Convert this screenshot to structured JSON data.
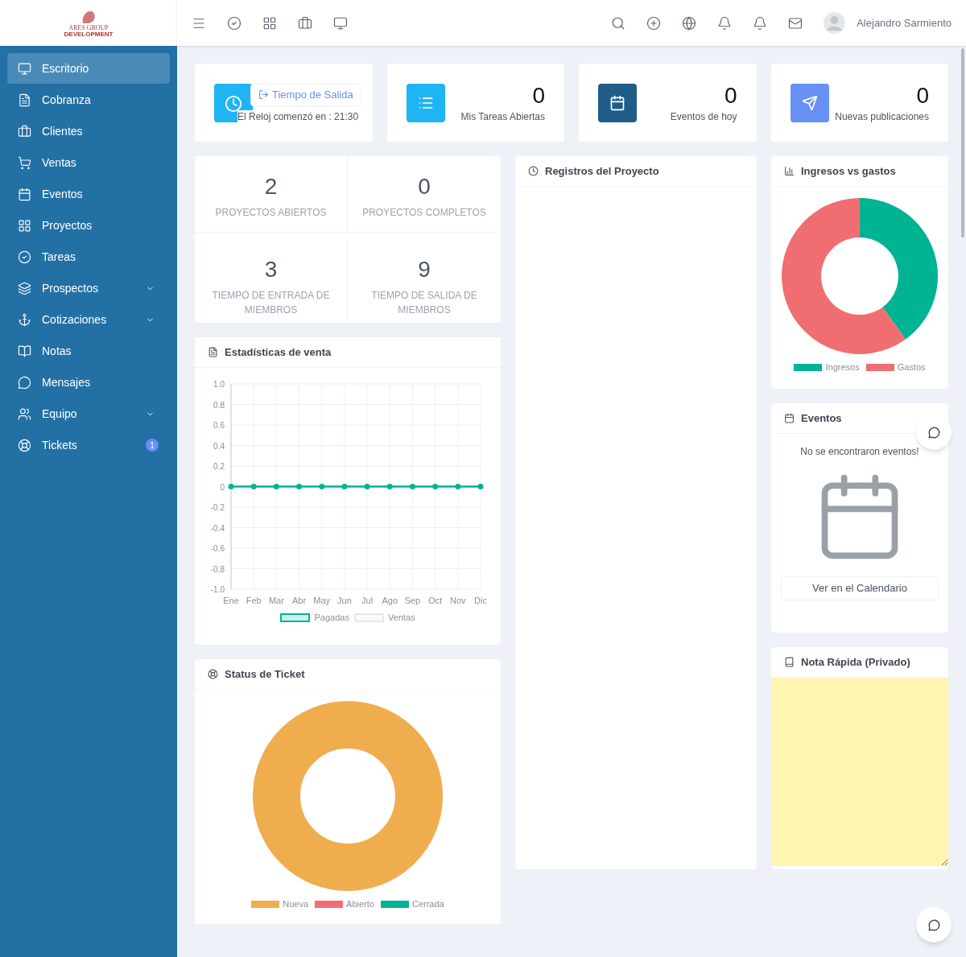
{
  "header": {
    "user_name": "Alejandro Sarmiento"
  },
  "logo": {
    "name": "ARES GROUP",
    "tagline": "DEVELOPMENT"
  },
  "sidebar": {
    "items": [
      {
        "label": "Escritorio",
        "selected": true,
        "has_submenu": false
      },
      {
        "label": "Cobranza",
        "selected": false,
        "has_submenu": false
      },
      {
        "label": "Clientes",
        "selected": false,
        "has_submenu": false
      },
      {
        "label": "Ventas",
        "selected": false,
        "has_submenu": false
      },
      {
        "label": "Eventos",
        "selected": false,
        "has_submenu": false
      },
      {
        "label": "Proyectos",
        "selected": false,
        "has_submenu": false
      },
      {
        "label": "Tareas",
        "selected": false,
        "has_submenu": false
      },
      {
        "label": "Prospectos",
        "selected": false,
        "has_submenu": true
      },
      {
        "label": "Cotizaciones",
        "selected": false,
        "has_submenu": true
      },
      {
        "label": "Notas",
        "selected": false,
        "has_submenu": false
      },
      {
        "label": "Mensajes",
        "selected": false,
        "has_submenu": false
      },
      {
        "label": "Equipo",
        "selected": false,
        "has_submenu": true
      },
      {
        "label": "Tickets",
        "selected": false,
        "has_submenu": false,
        "badge": "1"
      }
    ]
  },
  "clock_card": {
    "button": "Tiempo de Salida",
    "text": "El Reloj comenzó en : 21:30"
  },
  "stat_cards": [
    {
      "value": "0",
      "label": "Mis Tareas Abiertas",
      "color": "#1fb5f5"
    },
    {
      "value": "0",
      "label": "Eventos de hoy",
      "color": "#1f5c8a"
    },
    {
      "value": "0",
      "label": "Nuevas publicaciones",
      "color": "#6690f4"
    }
  ],
  "project_stats": [
    {
      "value": "2",
      "label": "PROYECTOS ABIERTOS"
    },
    {
      "value": "0",
      "label": "PROYECTOS COMPLETOS"
    },
    {
      "value": "3",
      "label": "TIEMPO DE ENTRADA DE MIEMBROS"
    },
    {
      "value": "9",
      "label": "TIEMPO DE SALIDA DE MIEMBROS"
    }
  ],
  "sales_stats": {
    "title": "Estadísticas de venta",
    "chart_data": {
      "type": "line",
      "categories": [
        "Ene",
        "Feb",
        "Mar",
        "Abr",
        "May",
        "Jun",
        "Jul",
        "Ago",
        "Sep",
        "Oct",
        "Nov",
        "Dic"
      ],
      "series": [
        {
          "name": "Pagadas",
          "color": "#00b393",
          "marker": true,
          "values": [
            0,
            0,
            0,
            0,
            0,
            0,
            0,
            0,
            0,
            0,
            0,
            0
          ]
        },
        {
          "name": "Ventas",
          "color": "#e5e7eb",
          "values": [
            null,
            null,
            null,
            null,
            null,
            null,
            null,
            null,
            null,
            null,
            null,
            null
          ]
        }
      ],
      "ylim": [
        -1,
        1
      ],
      "yticks": [
        {
          "value": 1,
          "label": "1.0"
        },
        {
          "value": 0.8,
          "label": "0.8"
        },
        {
          "value": 0.6,
          "label": "0.6"
        },
        {
          "value": 0.4,
          "label": "0.4"
        },
        {
          "value": 0.2,
          "label": "0.2"
        },
        {
          "value": 0,
          "label": "0"
        },
        {
          "value": -0.2,
          "label": "-0.2"
        },
        {
          "value": -0.4,
          "label": "-0.4"
        },
        {
          "value": -0.6,
          "label": "-0.6"
        },
        {
          "value": -0.8,
          "label": "-0.8"
        },
        {
          "value": -1,
          "label": "-1.0"
        }
      ]
    }
  },
  "ticket_status": {
    "title": "Status de Ticket",
    "legend": [
      {
        "label": "Nueva",
        "color": "#f0ad4e"
      },
      {
        "label": "Abierto",
        "color": "#f06e72"
      },
      {
        "label": "Cerrada",
        "color": "#00b393"
      }
    ]
  },
  "project_log": {
    "title": "Registros del Proyecto"
  },
  "income_expenses": {
    "title": "Ingresos vs gastos",
    "legend": [
      {
        "label": "Ingresos",
        "color": "#00b393"
      },
      {
        "label": "Gastos",
        "color": "#f06e72"
      }
    ]
  },
  "events": {
    "title": "Eventos",
    "empty_text": "No se encontraron eventos!",
    "button": "Ver en el Calendario"
  },
  "quick_note": {
    "title": "Nota Rápida (Privado)"
  }
}
